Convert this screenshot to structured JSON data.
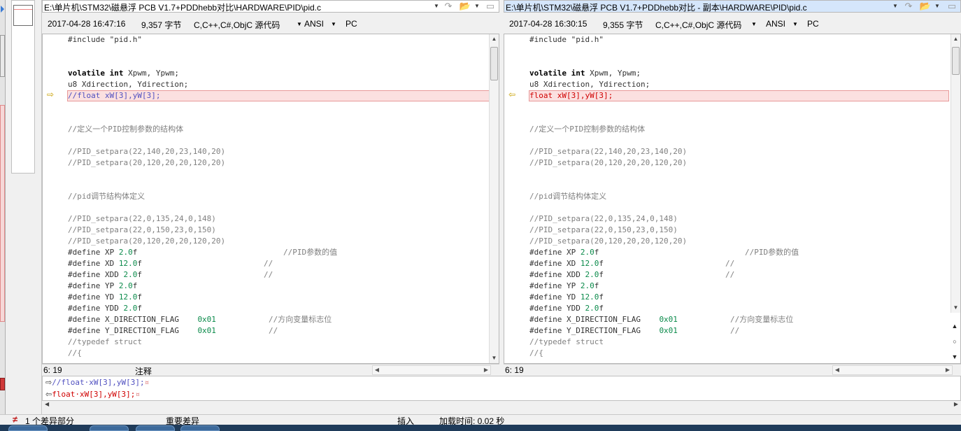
{
  "left": {
    "path": "E:\\单片机\\STM32\\磁悬浮 PCB V1.7+PDDhebb对比\\HARDWARE\\PID\\pid.c",
    "timestamp": "2017-04-28 16:47:16",
    "size": "9,357 字节",
    "language": "C,C++,C#,ObjC 源代码",
    "encoding": "ANSI",
    "lineending": "PC",
    "cursor": "6: 19",
    "status_label": "注释",
    "diff_line": "//float xW[3],yW[3];"
  },
  "right": {
    "path": "E:\\单片机\\STM32\\磁悬浮 PCB V1.7+PDDhebb对比 - 副本\\HARDWARE\\PID\\pid.c",
    "timestamp": "2017-04-28 16:30:15",
    "size": "9,355 字节",
    "language": "C,C++,C#,ObjC 源代码",
    "encoding": "ANSI",
    "lineending": "PC",
    "cursor": "6: 19",
    "diff_line": "float xW[3],yW[3];"
  },
  "code_common": {
    "include": "#include \"pid.h\"",
    "volatile_kw": "volatile int",
    "volatile_rest": " Xpwm, Ypwm;",
    "u8_line": "u8 Xdirection, Ydirection;",
    "cm_struct": "//定义一个PID控制参数的结构体",
    "cm_set1": "//PID_setpara(22,140,20,23,140,20)",
    "cm_set2": "//PID_setpara(20,120,20,20,120,20)",
    "cm_pid": "//pid调节结构体定义",
    "cm_set3": "//PID_setpara(22,0,135,24,0,148)",
    "cm_set4": "//PID_setpara(22,0,150,23,0,150)",
    "cm_set5": "//PID_setpara(20,120,20,20,120,20)",
    "define": "#define",
    "xp": " XP ",
    "xp_val": "2.0",
    "xp_cm": "//PID参数的值",
    "xd": " XD ",
    "xd_val": "12.0",
    "xdd": " XDD ",
    "xdd_val": "2.0",
    "yp": " YP ",
    "yp_val": "2.0",
    "yd": " YD ",
    "yd_val": "12.0",
    "ydd": " YDD ",
    "ydd_val": "2.0",
    "f": "f",
    "slashes": "//",
    "xflag": " X_DIRECTION_FLAG    ",
    "xflag_val": "0x01",
    "xflag_cm": "//方向变量标志位",
    "yflag": " Y_DIRECTION_FLAG    ",
    "yflag_val": "0x01",
    "typedef": "//typedef struct",
    "brace": "//{"
  },
  "compare": {
    "line1": "//float·xW[3],yW[3];",
    "line2": "float·xW[3],yW[3];"
  },
  "statusbar": {
    "diff_count": "1 个差异部分",
    "diff_type": "重要差异",
    "mode": "插入",
    "load_time": "加载时间: 0.02 秒"
  },
  "icons": {
    "nav_next_diff": "arrow-right-icon",
    "nav_prev_diff": "arrow-left-icon",
    "open_folder": "folder-icon",
    "save": "save-icon"
  }
}
